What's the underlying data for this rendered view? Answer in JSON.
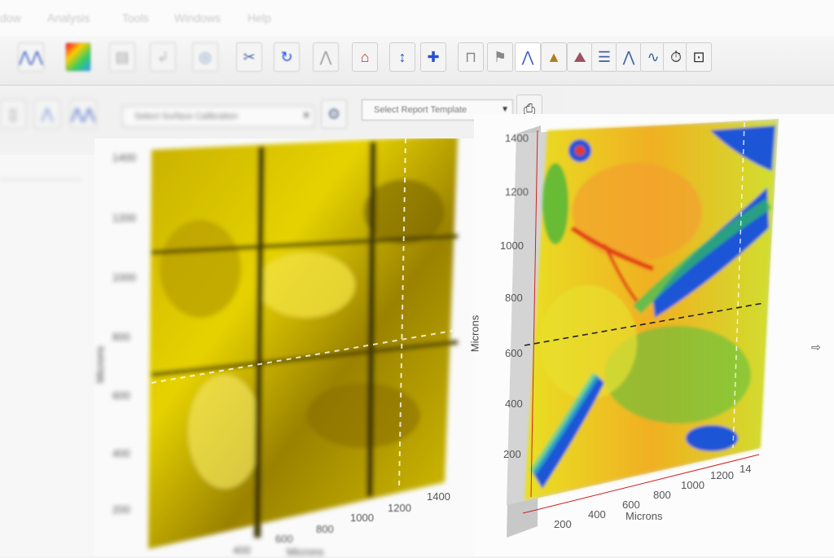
{
  "menu": {
    "items": [
      "dow",
      "Analysis",
      "Tools",
      "Windows",
      "Help"
    ]
  },
  "toolbar": {
    "buttons": [
      "line-profile-icon",
      "color-map-icon",
      "table-icon",
      "import-icon",
      "camera-icon",
      "cut-icon",
      "rotate-icon",
      "histogram-icon",
      "home-icon",
      "vertical-arrow-icon",
      "cross-move-icon",
      "step-height-icon",
      "flag-icon",
      "peak-icon",
      "triangle-icon",
      "surface-icon",
      "layers-icon",
      "spectrum-icon",
      "waveform-icon",
      "timer-icon",
      "export-icon"
    ]
  },
  "toolbar2": {
    "calibration_select": "Select Surface Calibration",
    "template_select": "Select Report Template",
    "print_icon": "print-icon"
  },
  "image1": {
    "ylabel": "Microns",
    "xlabel": "Microns",
    "y_ticks": [
      "1400",
      "1200",
      "1000",
      "800",
      "600",
      "400",
      "200"
    ],
    "x_ticks": [
      "400",
      "600",
      "800",
      "1000",
      "1200",
      "1400"
    ],
    "colormap": "yellow-gold"
  },
  "image2": {
    "ylabel": "Microns",
    "xlabel": "Microns",
    "y_ticks": [
      "1400",
      "1200",
      "1000",
      "800",
      "600",
      "400",
      "200"
    ],
    "x_ticks": [
      "200",
      "400",
      "600",
      "800",
      "1000",
      "1200",
      "14"
    ],
    "colormap": "rainbow"
  },
  "colors": {
    "yellow_map": "#d8c000",
    "rainbow_blue": "#1b55d6",
    "rainbow_red": "#e23a12",
    "tick_red": "#d02020"
  }
}
